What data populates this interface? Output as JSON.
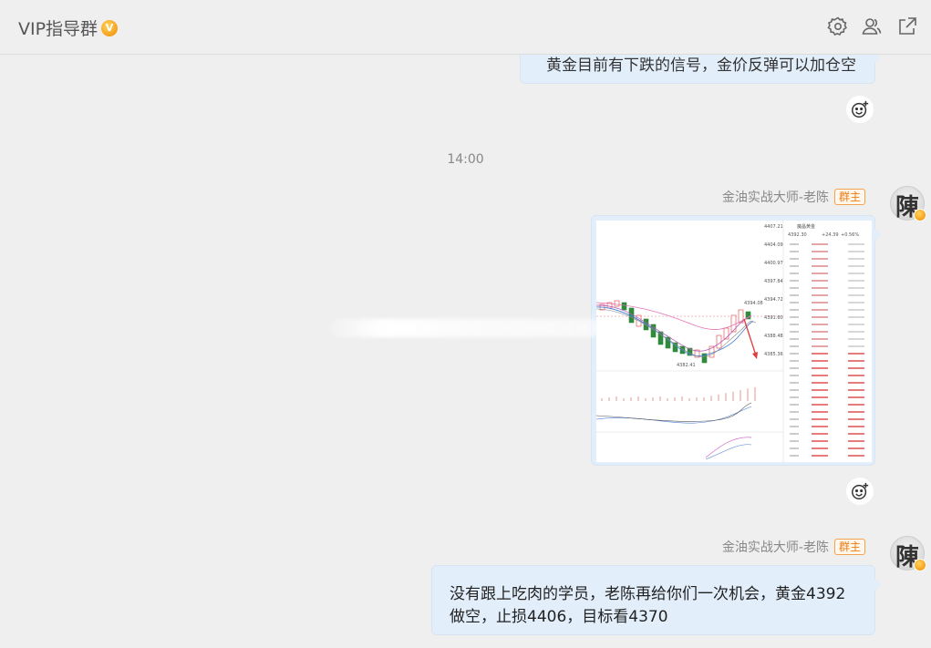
{
  "header": {
    "title": "VIP指导群",
    "badge": "V"
  },
  "messages": {
    "top_text": "黄金目前有下跌的信号，金价反弹可以加仓空",
    "time_separator": "14:00",
    "image_msg": {
      "sender": "金油实战大师-老陈",
      "tag": "群主",
      "avatar_char": "陳"
    },
    "text_msg": {
      "sender": "金油实战大师-老陈",
      "tag": "群主",
      "avatar_char": "陳",
      "line1": "没有跟上吃肉的学员，老陈再给你们一次机会，黄金4392",
      "line2": "做空，止损4406，目标看4370"
    }
  },
  "chart_data": {
    "type": "candlestick",
    "title": "魔晶黄金",
    "price": "4392.30",
    "change": "+24.39",
    "change_pct": "+0.56%",
    "y_ticks": [
      "4407.21",
      "4404.09",
      "4400.97",
      "4397.84",
      "4394.72",
      "4391.60",
      "4388.48",
      "4385.36"
    ],
    "labels": [
      "4394.08",
      "4382.41"
    ]
  },
  "colors": {
    "bubble": "#e3eefb",
    "owner_tag": "#ee7c12",
    "bg": "#efefef"
  },
  "icons": [
    "settings-icon",
    "members-icon",
    "popout-icon",
    "emoji-react-icon"
  ]
}
